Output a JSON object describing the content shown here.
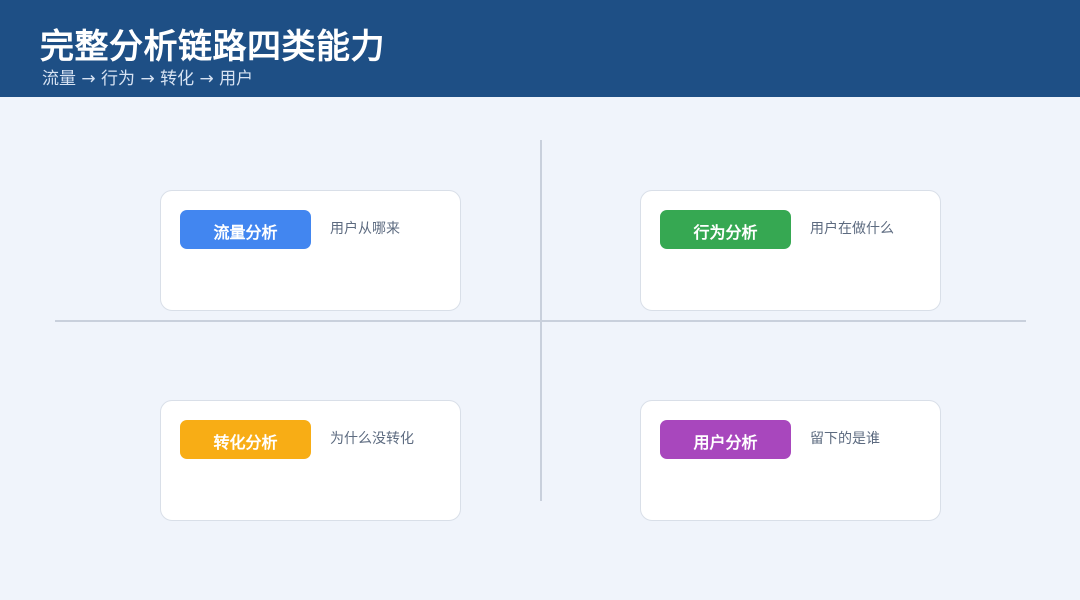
{
  "header": {
    "title": "完整分析链路四类能力",
    "subtitle": "流量 → 行为 → 转化 → 用户"
  },
  "quadrants": [
    {
      "label": "流量分析",
      "description": "用户从哪来",
      "color": "#4286f0"
    },
    {
      "label": "行为分析",
      "description": "用户在做什么",
      "color": "#36a852"
    },
    {
      "label": "转化分析",
      "description": "为什么没转化",
      "color": "#f8ad15"
    },
    {
      "label": "用户分析",
      "description": "留下的是谁",
      "color": "#a847bd"
    }
  ]
}
